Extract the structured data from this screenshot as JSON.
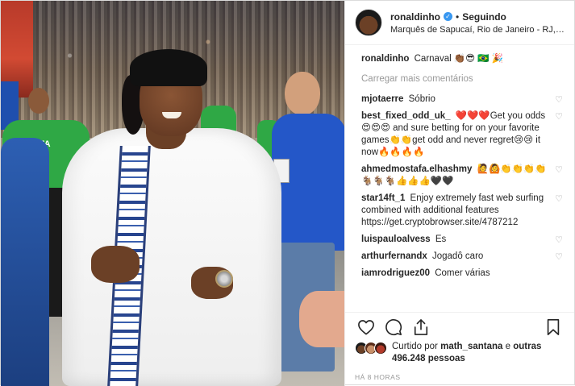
{
  "header": {
    "username": "ronaldinho",
    "follow_label": "Seguindo",
    "dot": "•",
    "verified_mark": "✓",
    "location": "Marquês de Sapucaí, Rio de Janeiro - RJ, B..."
  },
  "photo": {
    "pista_text": "PISTA"
  },
  "caption": {
    "username": "ronaldinho",
    "text": "Carnaval 👏🏾😎 🇧🇷 🎉"
  },
  "load_more_label": "Carregar mais comentários",
  "comments": [
    {
      "username": "mjotaerre",
      "text": "Sóbrio"
    },
    {
      "username": "best_fixed_odd_uk_",
      "text": "❤️❤️❤️Get you odds😍😍😍 and sure betting for on your favorite games👏👏get odd and never regret😢😢 it now🔥🔥🔥🔥"
    },
    {
      "username": "ahmedmostafa.elhashmy",
      "text": "🙋🙆👏👏👏👏🐐🐐🐐👍👍👍🖤🖤"
    },
    {
      "username": "star14ft_1",
      "text": "Enjoy extremely fast web surfing combined with additional features https://get.cryptobrowser.site/4787212"
    },
    {
      "username": "luispauloalvess",
      "text": "Es"
    },
    {
      "username": "arthurfernandx",
      "text": "Jogadô caro"
    },
    {
      "username": "iamrodriguez00",
      "text": "Comer várias"
    }
  ],
  "likes": {
    "prefix": "Curtido por",
    "user": "math_santana",
    "middle": "e",
    "others": "outras 496.248 pessoas"
  },
  "timestamp": "HÁ 8 HORAS",
  "icons": {
    "like": "heart-outline",
    "comment": "speech-bubble",
    "share": "share-arrow",
    "save": "bookmark",
    "comment_like": "heart-small"
  },
  "colors": {
    "verified": "#3897f0",
    "muted": "#999999",
    "text": "#262626"
  }
}
